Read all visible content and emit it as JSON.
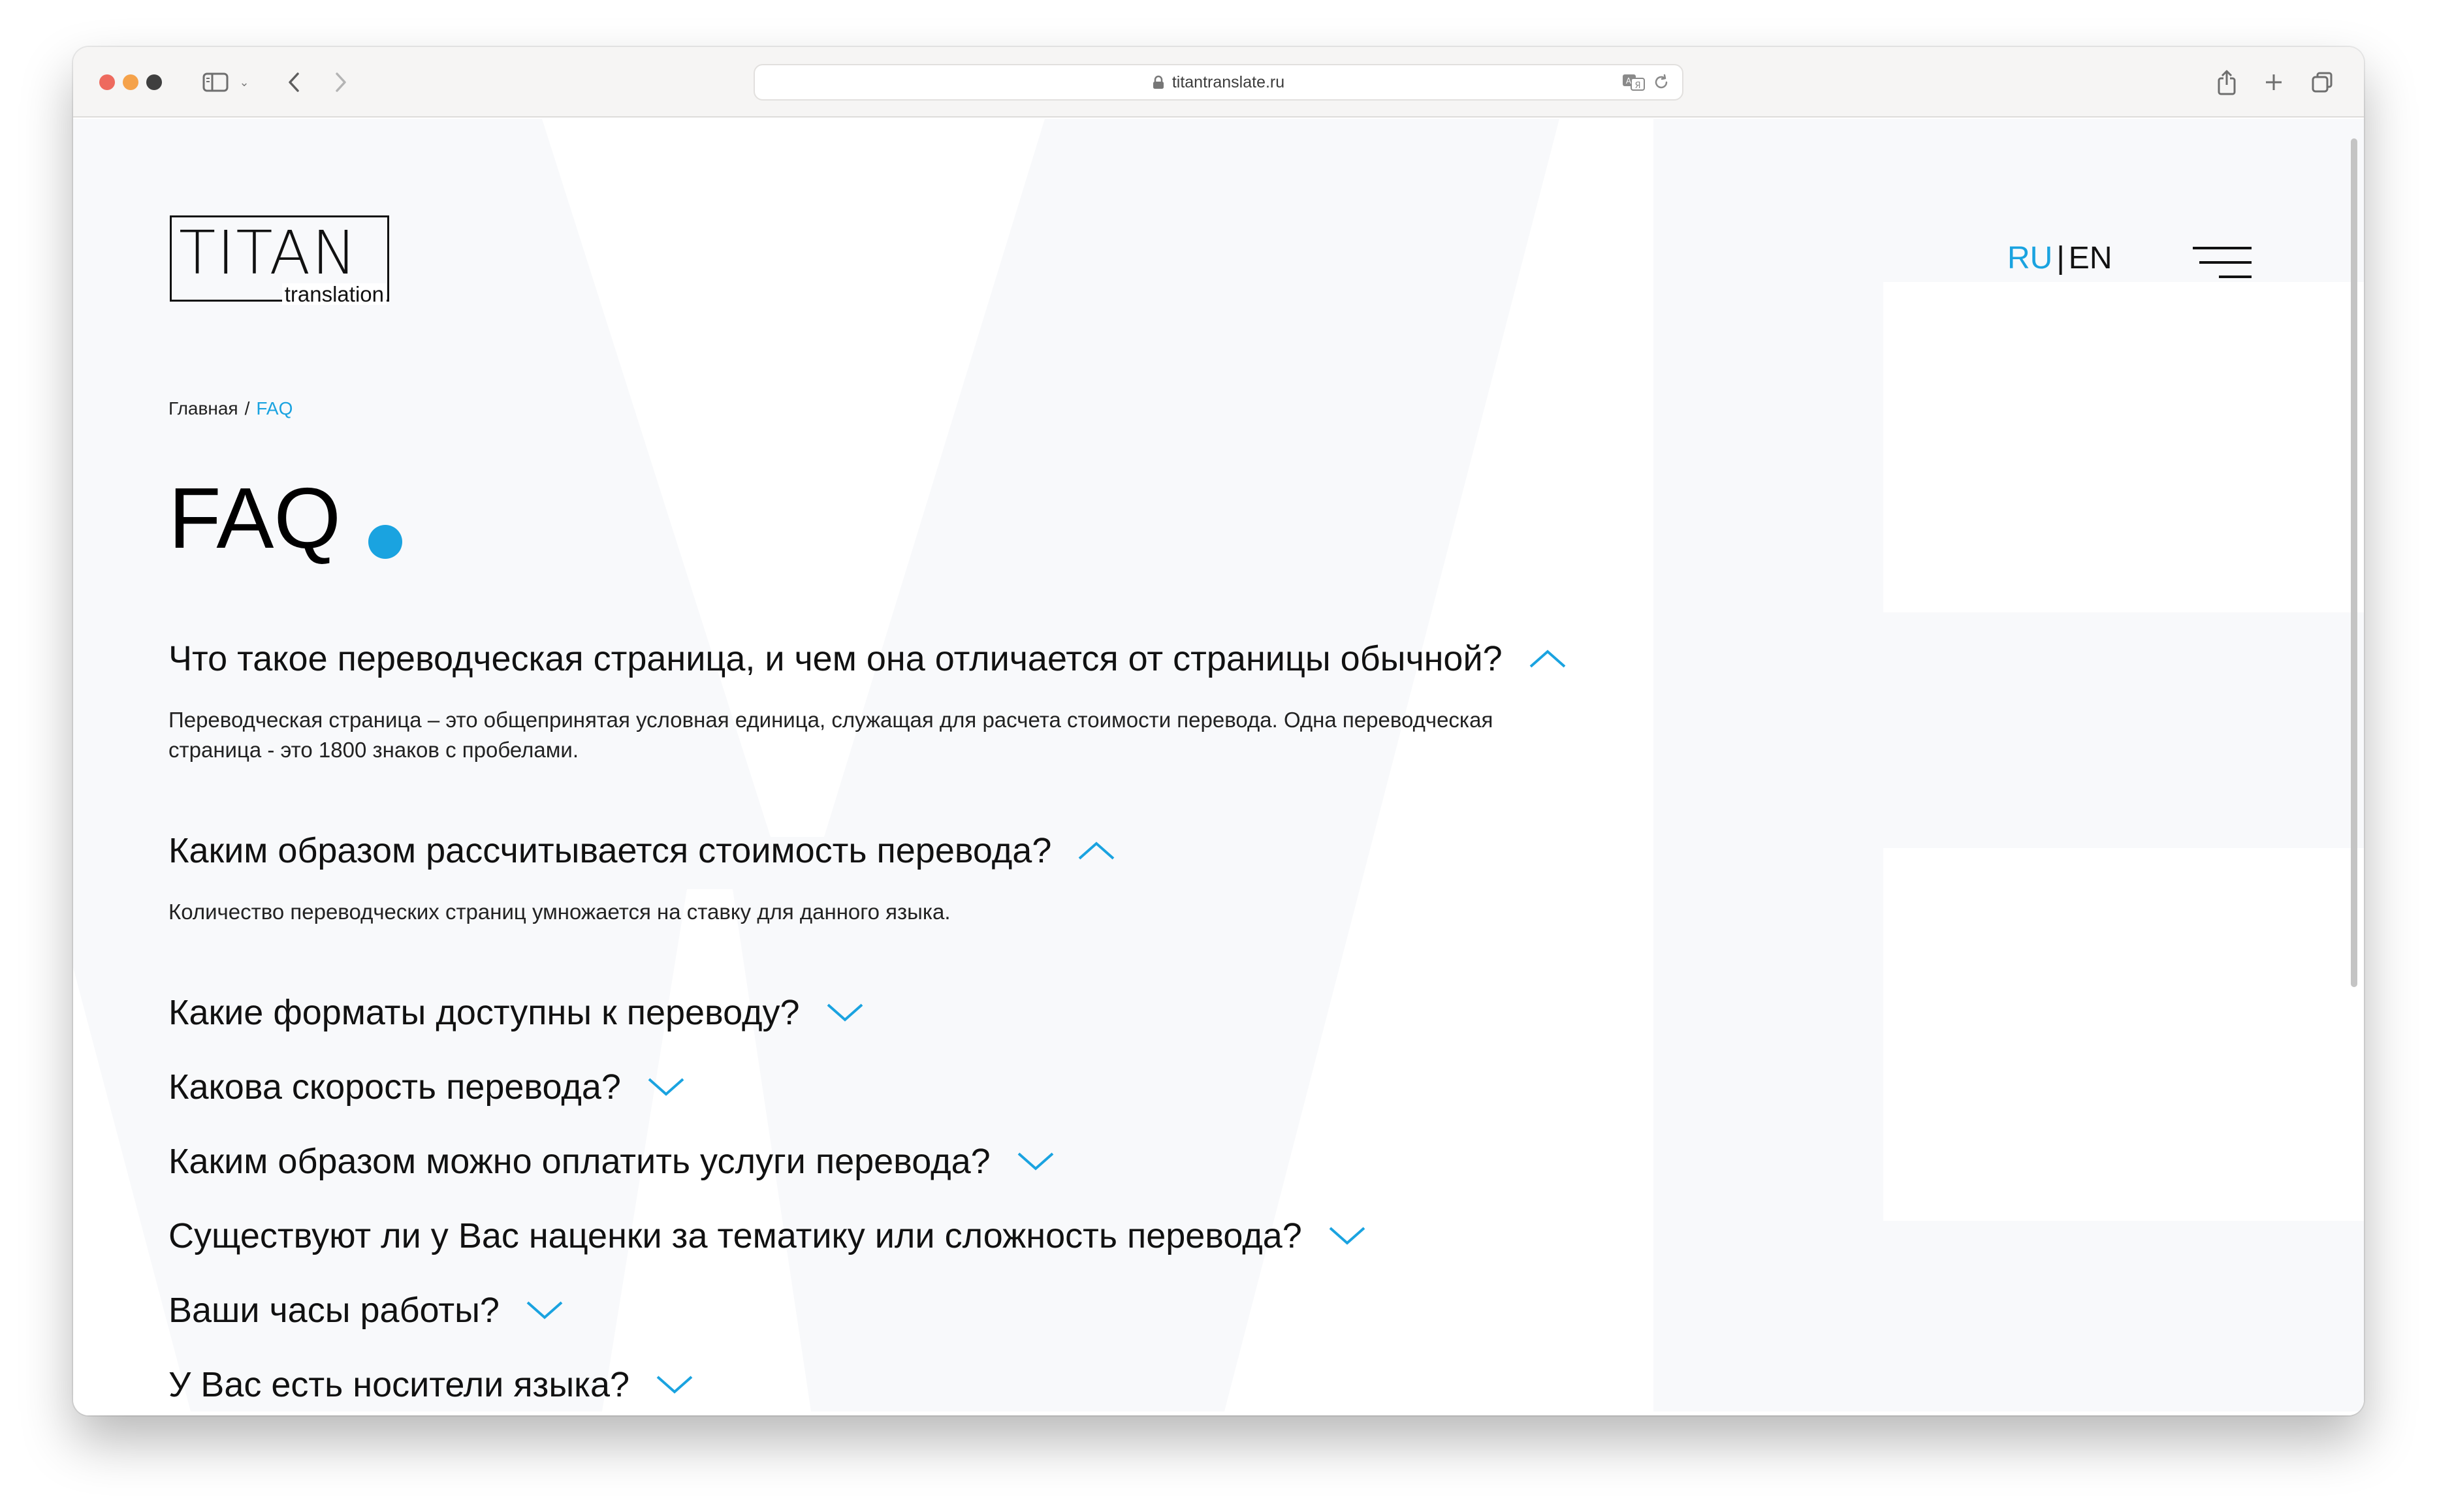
{
  "browser": {
    "url": "titantranslate.ru"
  },
  "logo": {
    "title": "TITAN",
    "subtitle": "translation"
  },
  "header": {
    "lang_ru": "RU",
    "lang_sep": "|",
    "lang_en": "EN"
  },
  "breadcrumb": {
    "home": "Главная",
    "sep": "/",
    "current": "FAQ"
  },
  "page_title": "FAQ",
  "colors": {
    "accent": "#1aa3e0",
    "text": "#111111"
  },
  "faq": [
    {
      "question": "Что такое переводческая страница, и чем она отличается от страницы обычной?",
      "answer": "Переводческая страница – это общепринятая условная единица, служащая для расчета стоимости перевода. Одна переводческая страница - это 1800 знаков с пробелами.",
      "expanded": true
    },
    {
      "question": "Каким образом рассчитывается стоимость перевода?",
      "answer": "Количество переводческих страниц умножается на ставку для данного языка.",
      "expanded": true
    },
    {
      "question": "Какие форматы доступны к переводу?",
      "expanded": false
    },
    {
      "question": "Какова скорость перевода?",
      "expanded": false
    },
    {
      "question": "Каким образом можно оплатить услуги перевода?",
      "expanded": false
    },
    {
      "question": "Существуют ли у Вас наценки за тематику или сложность перевода?",
      "expanded": false
    },
    {
      "question": "Ваши часы работы?",
      "expanded": false
    },
    {
      "question": "У Вас есть носители языка?",
      "expanded": false
    }
  ]
}
